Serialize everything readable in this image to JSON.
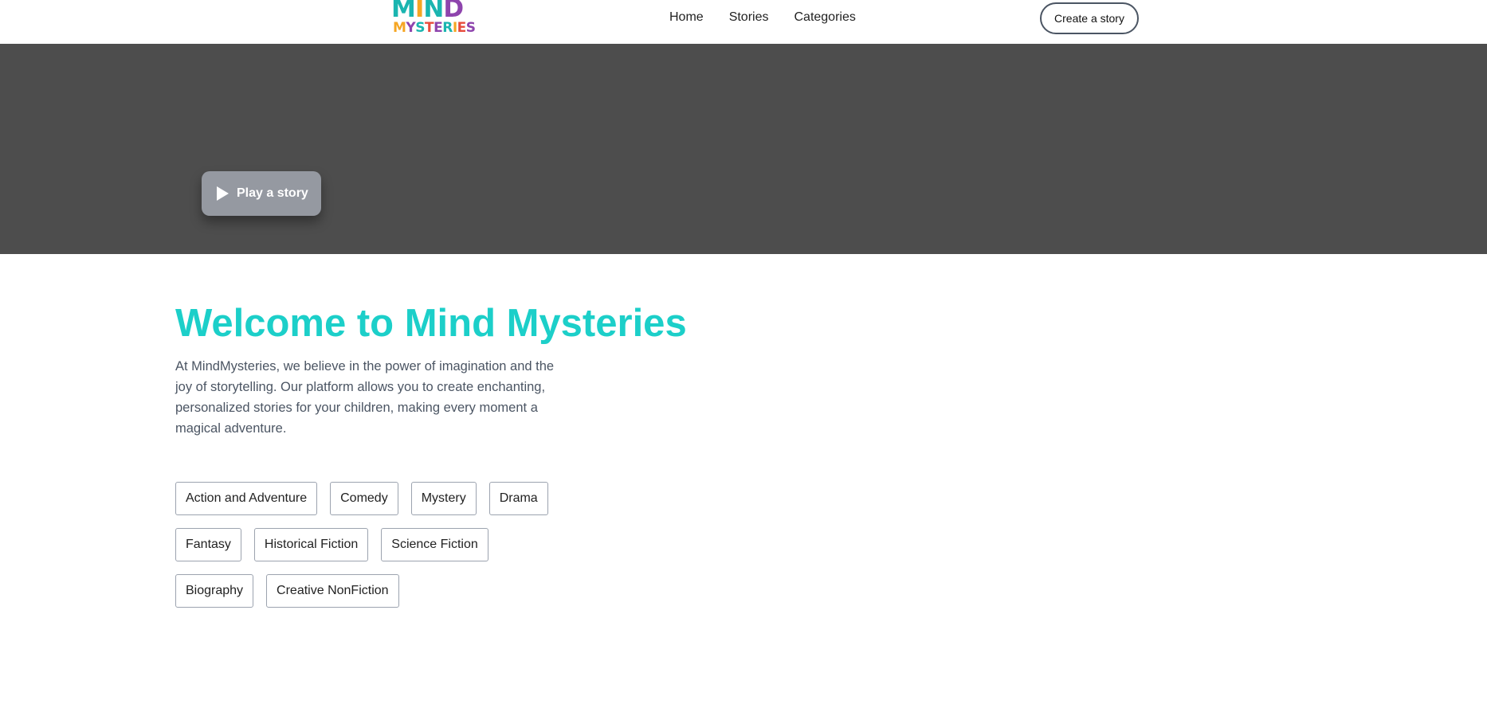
{
  "header": {
    "logo": {
      "line1": [
        {
          "ch": "M",
          "color": "#1ab5b0"
        },
        {
          "ch": "I",
          "color": "#f5a623"
        },
        {
          "ch": "N",
          "color": "#1ab5b0"
        },
        {
          "ch": "D",
          "color": "#8e44ad"
        }
      ],
      "line2": [
        {
          "ch": "M",
          "color": "#f5a623"
        },
        {
          "ch": "Y",
          "color": "#8e44ad"
        },
        {
          "ch": "S",
          "color": "#1ab5b0"
        },
        {
          "ch": "T",
          "color": "#e74c3c"
        },
        {
          "ch": "E",
          "color": "#8e44ad"
        },
        {
          "ch": "R",
          "color": "#1ab5b0"
        },
        {
          "ch": "I",
          "color": "#f5a623"
        },
        {
          "ch": "E",
          "color": "#e74c3c"
        },
        {
          "ch": "S",
          "color": "#8e44ad"
        }
      ]
    },
    "nav": {
      "home": "Home",
      "stories": "Stories",
      "categories": "Categories"
    },
    "cta_label": "Create a story"
  },
  "hero": {
    "background_color": "#4d4d4d",
    "play_label": "Play a story",
    "play_icon": "play-icon"
  },
  "main": {
    "title": "Welcome to Mind Mysteries",
    "title_color": "#1ccfc9",
    "intro": "At MindMysteries, we believe in the power of imagination and the joy of storytelling. Our platform allows you to create enchanting, personalized stories for your children, making every moment a magical adventure."
  },
  "categories": [
    [
      "Action and Adventure",
      "Comedy",
      "Mystery",
      "Drama"
    ],
    [
      "Fantasy",
      "Historical Fiction",
      "Science Fiction"
    ],
    [
      "Biography",
      "Creative NonFiction"
    ]
  ]
}
